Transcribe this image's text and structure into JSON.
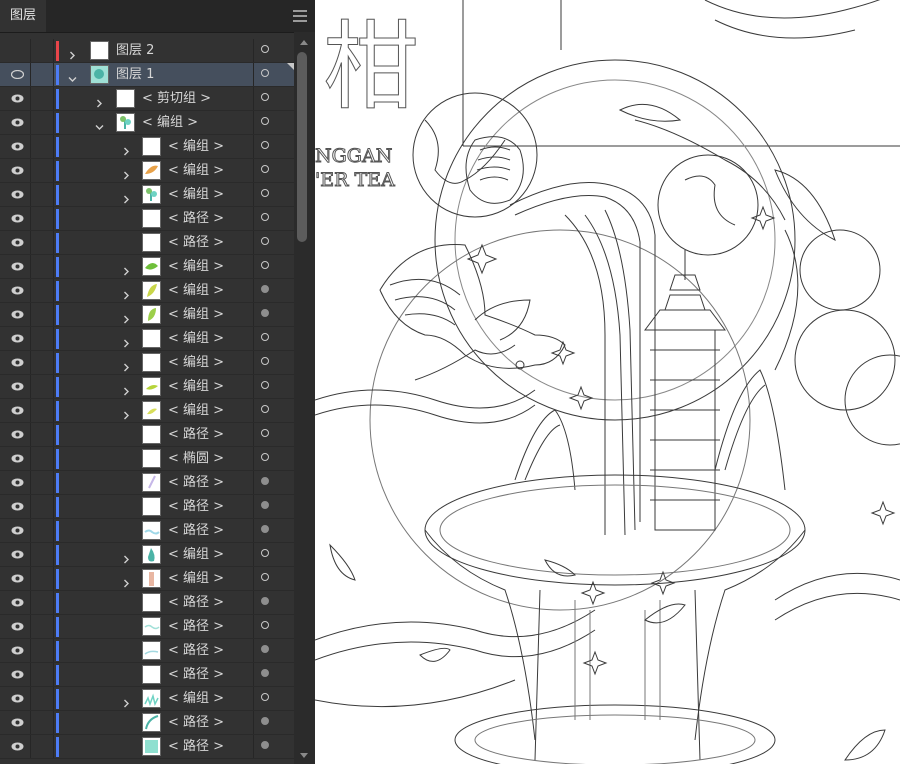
{
  "panel": {
    "tab_label": "图层",
    "menu_icon": "hamburger-menu-icon",
    "rows": [
      {
        "label": "图层 2",
        "indent": 0,
        "expander": "collapsed",
        "thumb": "blank",
        "color": "red",
        "target": "empty",
        "selected": false,
        "eye": false
      },
      {
        "label": "图层 1",
        "indent": 0,
        "expander": "expanded",
        "thumb": "art",
        "color": "blue",
        "target": "empty",
        "selected": true,
        "eye": "outline"
      },
      {
        "label": "< 剪切组 >",
        "indent": 1,
        "expander": "collapsed",
        "thumb": "blank",
        "color": "blue",
        "target": "empty",
        "selected": false,
        "eye": true
      },
      {
        "label": "< 编组 >",
        "indent": 1,
        "expander": "expanded",
        "thumb": "plant",
        "color": "blue",
        "target": "empty",
        "selected": false,
        "eye": true
      },
      {
        "label": "< 编组 >",
        "indent": 2,
        "expander": "collapsed",
        "thumb": "blank",
        "color": "blue",
        "target": "empty",
        "selected": false,
        "eye": true
      },
      {
        "label": "< 编组 >",
        "indent": 2,
        "expander": "collapsed",
        "thumb": "bird",
        "color": "blue",
        "target": "empty",
        "selected": false,
        "eye": true
      },
      {
        "label": "< 编组 >",
        "indent": 2,
        "expander": "collapsed",
        "thumb": "plant",
        "color": "blue",
        "target": "empty",
        "selected": false,
        "eye": true
      },
      {
        "label": "< 路径 >",
        "indent": 2,
        "expander": "none",
        "thumb": "blank",
        "color": "blue",
        "target": "empty",
        "selected": false,
        "eye": true
      },
      {
        "label": "< 路径 >",
        "indent": 2,
        "expander": "none",
        "thumb": "blank",
        "color": "blue",
        "target": "empty",
        "selected": false,
        "eye": true
      },
      {
        "label": "< 编组 >",
        "indent": 2,
        "expander": "collapsed",
        "thumb": "leaf",
        "color": "blue",
        "target": "empty",
        "selected": false,
        "eye": true
      },
      {
        "label": "< 编组 >",
        "indent": 2,
        "expander": "collapsed",
        "thumb": "leaf2",
        "color": "blue",
        "target": "filled",
        "selected": false,
        "eye": true
      },
      {
        "label": "< 编组 >",
        "indent": 2,
        "expander": "collapsed",
        "thumb": "leaf3",
        "color": "blue",
        "target": "filled",
        "selected": false,
        "eye": true
      },
      {
        "label": "< 编组 >",
        "indent": 2,
        "expander": "collapsed",
        "thumb": "blank",
        "color": "blue",
        "target": "empty",
        "selected": false,
        "eye": true
      },
      {
        "label": "< 编组 >",
        "indent": 2,
        "expander": "collapsed",
        "thumb": "blank",
        "color": "blue",
        "target": "empty",
        "selected": false,
        "eye": true
      },
      {
        "label": "< 编组 >",
        "indent": 2,
        "expander": "collapsed",
        "thumb": "leaf4",
        "color": "blue",
        "target": "empty",
        "selected": false,
        "eye": true
      },
      {
        "label": "< 编组 >",
        "indent": 2,
        "expander": "collapsed",
        "thumb": "leaf5",
        "color": "blue",
        "target": "empty",
        "selected": false,
        "eye": true
      },
      {
        "label": "< 路径 >",
        "indent": 2,
        "expander": "none",
        "thumb": "blank",
        "color": "blue",
        "target": "empty",
        "selected": false,
        "eye": true
      },
      {
        "label": "< 椭圆 >",
        "indent": 2,
        "expander": "none",
        "thumb": "blank",
        "color": "blue",
        "target": "empty",
        "selected": false,
        "eye": true
      },
      {
        "label": "< 路径 >",
        "indent": 2,
        "expander": "none",
        "thumb": "stroke",
        "color": "blue",
        "target": "filled",
        "selected": false,
        "eye": true
      },
      {
        "label": "< 路径 >",
        "indent": 2,
        "expander": "none",
        "thumb": "blank",
        "color": "blue",
        "target": "filled",
        "selected": false,
        "eye": true
      },
      {
        "label": "< 路径 >",
        "indent": 2,
        "expander": "none",
        "thumb": "wave",
        "color": "blue",
        "target": "filled",
        "selected": false,
        "eye": true
      },
      {
        "label": "< 编组 >",
        "indent": 2,
        "expander": "collapsed",
        "thumb": "drop",
        "color": "blue",
        "target": "empty",
        "selected": false,
        "eye": true
      },
      {
        "label": "< 编组 >",
        "indent": 2,
        "expander": "collapsed",
        "thumb": "tower",
        "color": "blue",
        "target": "empty",
        "selected": false,
        "eye": true
      },
      {
        "label": "< 路径 >",
        "indent": 2,
        "expander": "none",
        "thumb": "blank",
        "color": "blue",
        "target": "filled",
        "selected": false,
        "eye": true
      },
      {
        "label": "< 路径 >",
        "indent": 2,
        "expander": "none",
        "thumb": "wave2",
        "color": "blue",
        "target": "empty",
        "selected": false,
        "eye": true
      },
      {
        "label": "< 路径 >",
        "indent": 2,
        "expander": "none",
        "thumb": "wave3",
        "color": "blue",
        "target": "filled",
        "selected": false,
        "eye": true
      },
      {
        "label": "< 路径 >",
        "indent": 2,
        "expander": "none",
        "thumb": "blank",
        "color": "blue",
        "target": "filled",
        "selected": false,
        "eye": true
      },
      {
        "label": "< 编组 >",
        "indent": 2,
        "expander": "collapsed",
        "thumb": "grass",
        "color": "blue",
        "target": "empty",
        "selected": false,
        "eye": true
      },
      {
        "label": "< 路径 >",
        "indent": 2,
        "expander": "none",
        "thumb": "curve",
        "color": "blue",
        "target": "filled",
        "selected": false,
        "eye": true
      },
      {
        "label": "< 路径 >",
        "indent": 2,
        "expander": "none",
        "thumb": "teal",
        "color": "blue",
        "target": "filled",
        "selected": false,
        "eye": true
      }
    ]
  },
  "canvas": {
    "title_char": "柑",
    "subtitle_line1": "NGGAN",
    "subtitle_line2": "'ER TEA"
  },
  "colors": {
    "panel_bg": "#323232",
    "header_bg": "#262626",
    "selected_row": "#454f5d",
    "layer_blue": "#4d7cf5",
    "layer_red": "#e8454a",
    "thumb_green": "#7cc26a",
    "thumb_teal": "#6fd3c4",
    "thumb_orange": "#e8a24a"
  }
}
